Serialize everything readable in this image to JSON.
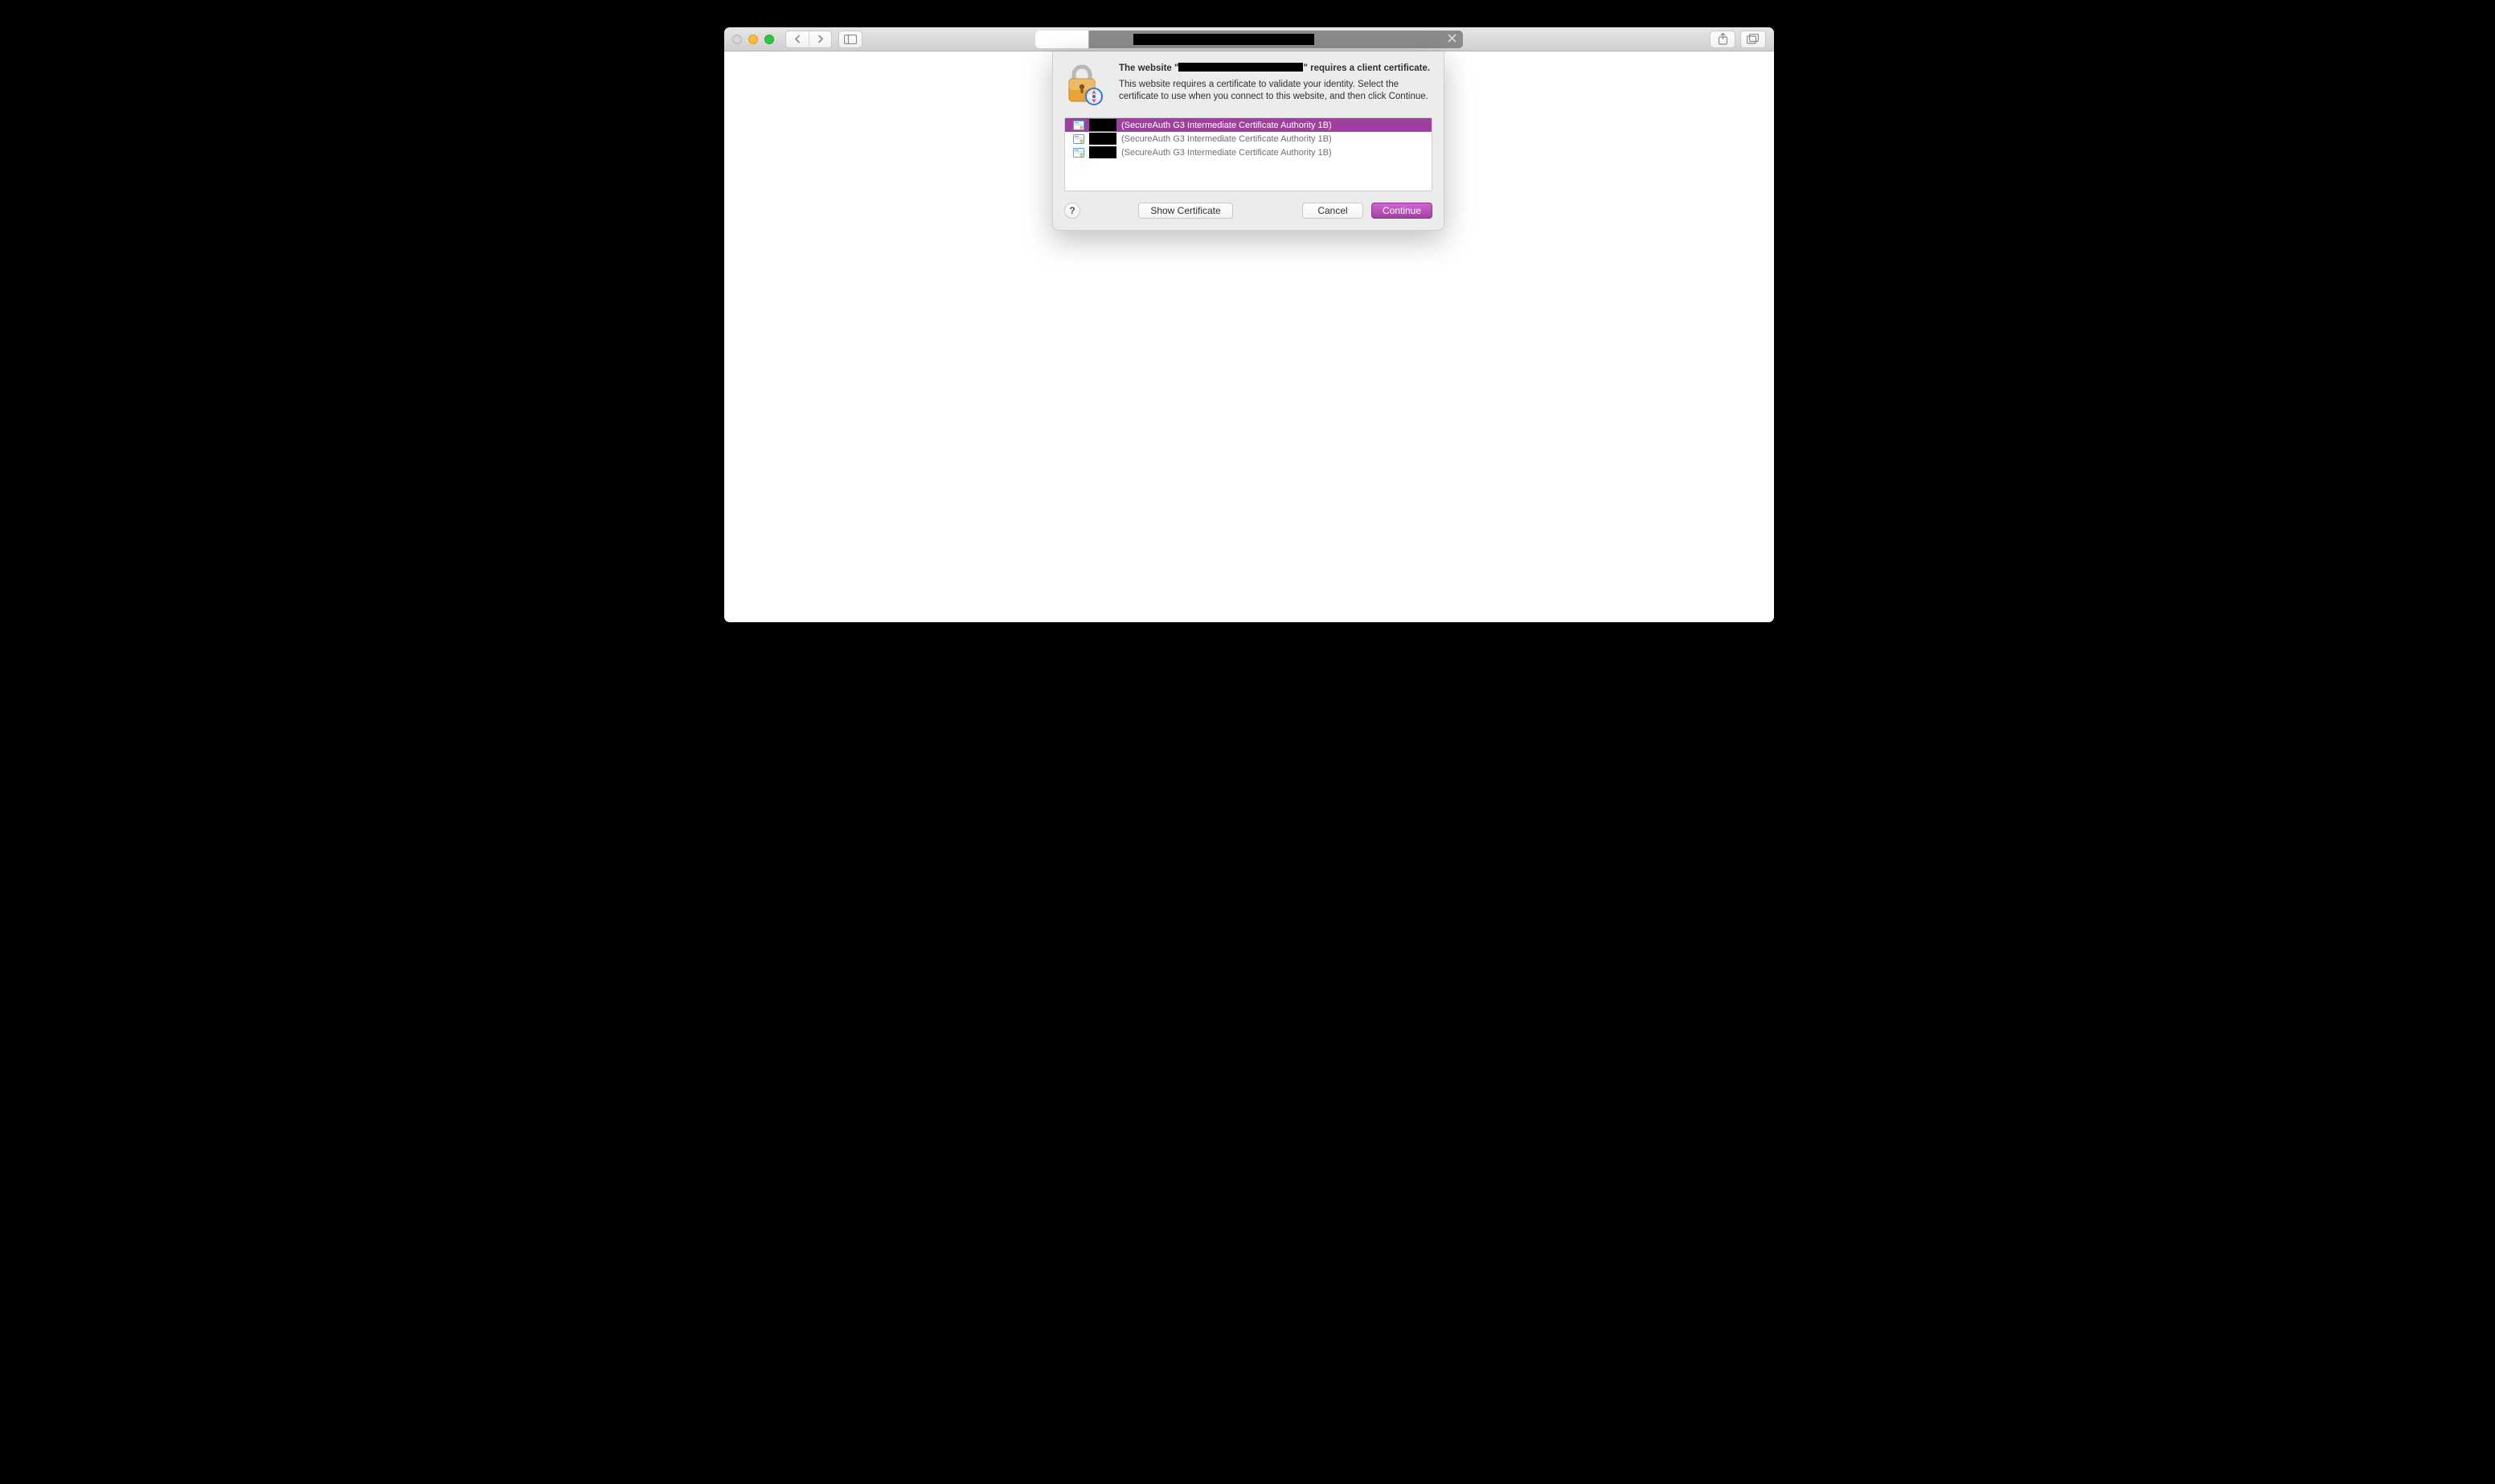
{
  "sheet": {
    "title_prefix": "The website \"",
    "title_suffix": "\" requires a client certificate.",
    "description": "This website requires a certificate to validate your identity. Select the certificate to use when you connect to this website, and then click Continue.",
    "certificates": [
      {
        "issuer": "(SecureAuth G3 Intermediate Certificate Authority 1B)",
        "selected": true
      },
      {
        "issuer": "(SecureAuth G3 Intermediate Certificate Authority 1B)",
        "selected": false
      },
      {
        "issuer": "(SecureAuth G3 Intermediate Certificate Authority 1B)",
        "selected": false
      }
    ],
    "buttons": {
      "help": "?",
      "show_certificate": "Show Certificate",
      "cancel": "Cancel",
      "continue": "Continue"
    }
  },
  "toolbar": {
    "new_tab": "+"
  }
}
